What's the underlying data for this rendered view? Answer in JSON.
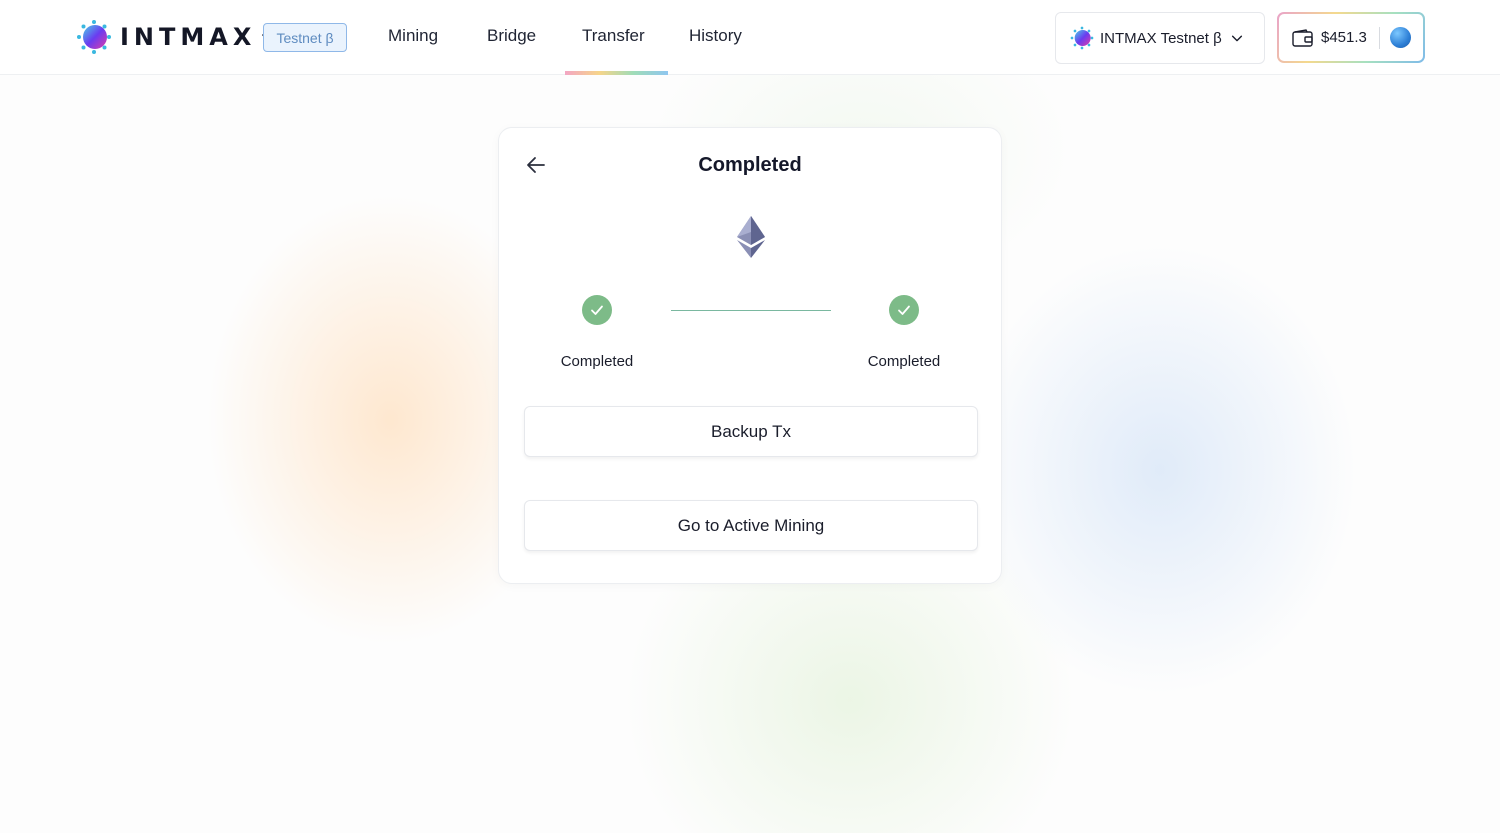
{
  "header": {
    "logo_text": "INTMAX",
    "badge": "Testnet β",
    "nav": [
      {
        "label": "Mining"
      },
      {
        "label": "Bridge"
      },
      {
        "label": "Transfer",
        "active": true
      },
      {
        "label": "History"
      }
    ],
    "network": {
      "label": "INTMAX Testnet β",
      "icon": "intmax-logo-icon"
    },
    "wallet": {
      "amount": "$451.3",
      "icon": "wallet-icon"
    }
  },
  "card": {
    "title": "Completed",
    "token_icon": "ethereum-icon",
    "steps": [
      {
        "label": "Completed",
        "status": "completed"
      },
      {
        "label": "Completed",
        "status": "completed"
      }
    ],
    "buttons": {
      "backup": "Backup Tx",
      "mining": "Go to Active Mining"
    }
  },
  "colors": {
    "check_green": "#7dbb88",
    "badge_border": "#8fb8e8",
    "badge_text": "#5f8cc0"
  }
}
